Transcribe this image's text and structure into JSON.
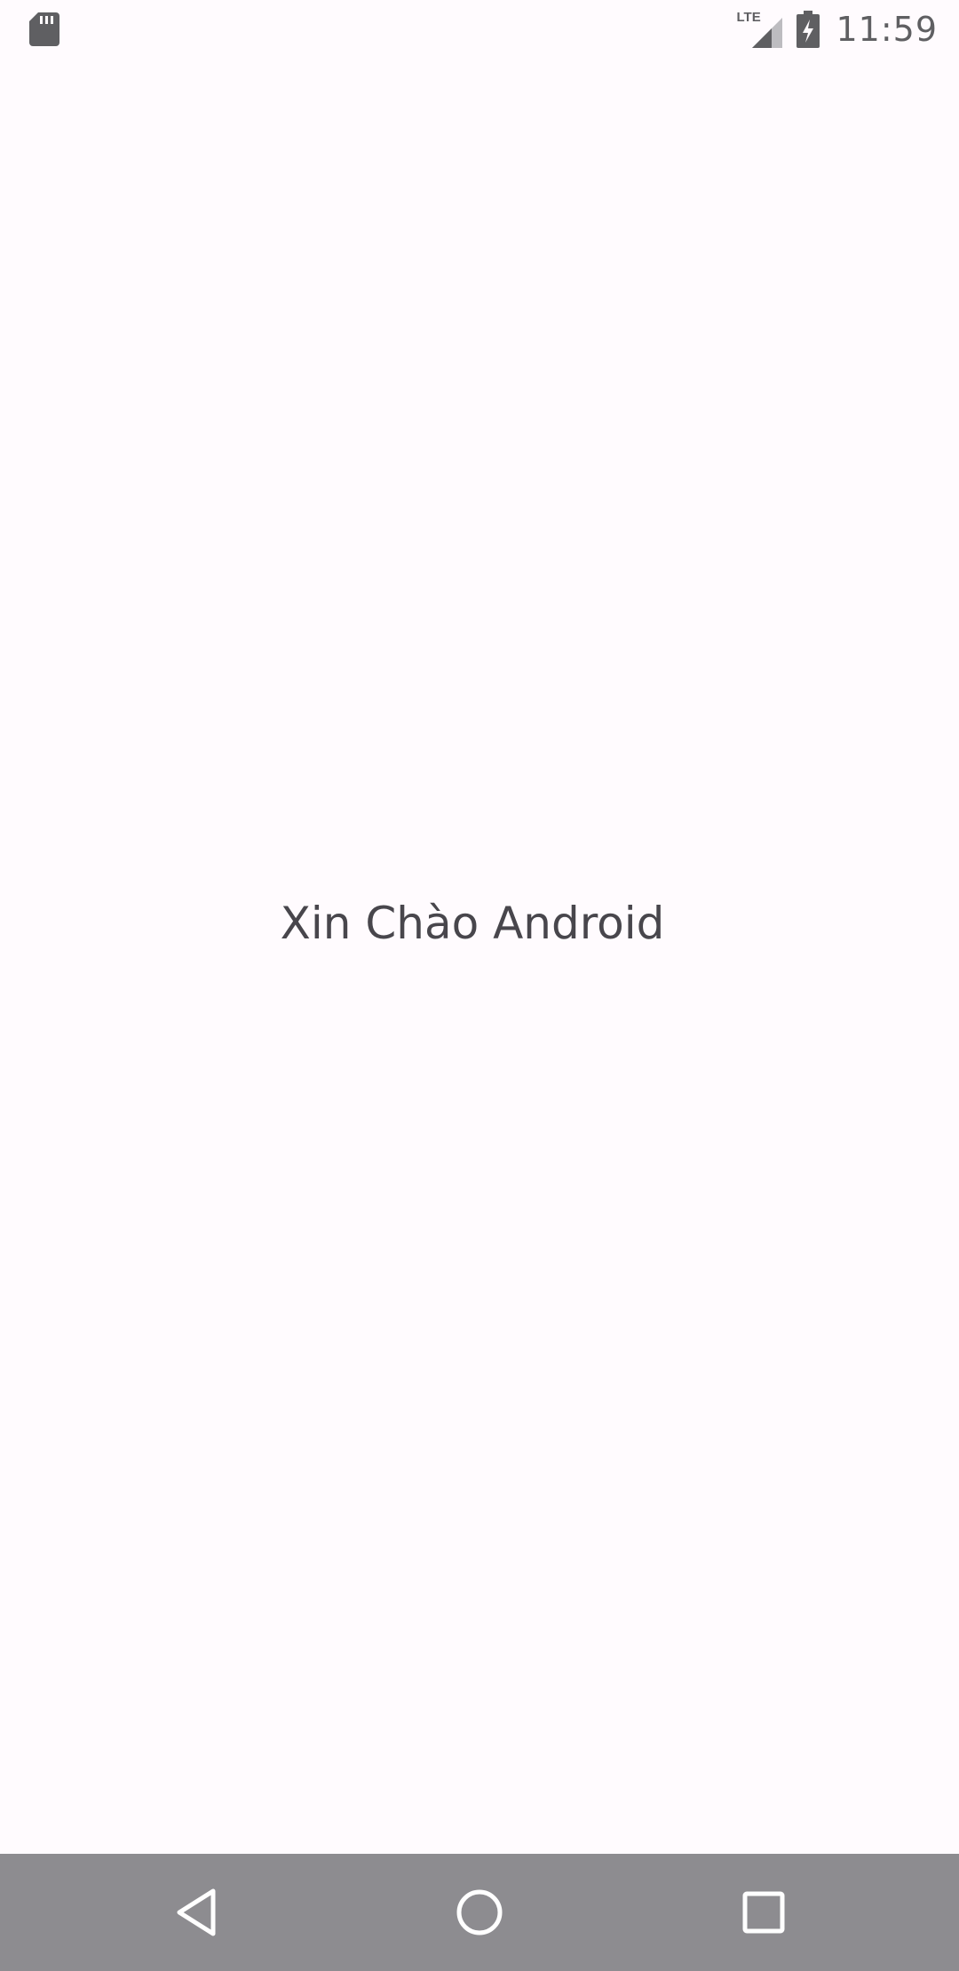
{
  "status_bar": {
    "left_icon": "sd-card-icon",
    "network_label": "LTE",
    "signal_icon": "signal-icon",
    "battery_icon": "battery-charging-icon",
    "time": "11:59"
  },
  "main": {
    "greeting": "Xin Chào Android"
  },
  "nav_bar": {
    "back_icon": "back-icon",
    "home_icon": "home-icon",
    "recents_icon": "recents-icon"
  },
  "colors": {
    "background": "#fffbfe",
    "text": "#48464c",
    "status_icons": "#5f5f62",
    "nav_bar": "#8d8c90",
    "nav_icons": "#ffffff"
  }
}
